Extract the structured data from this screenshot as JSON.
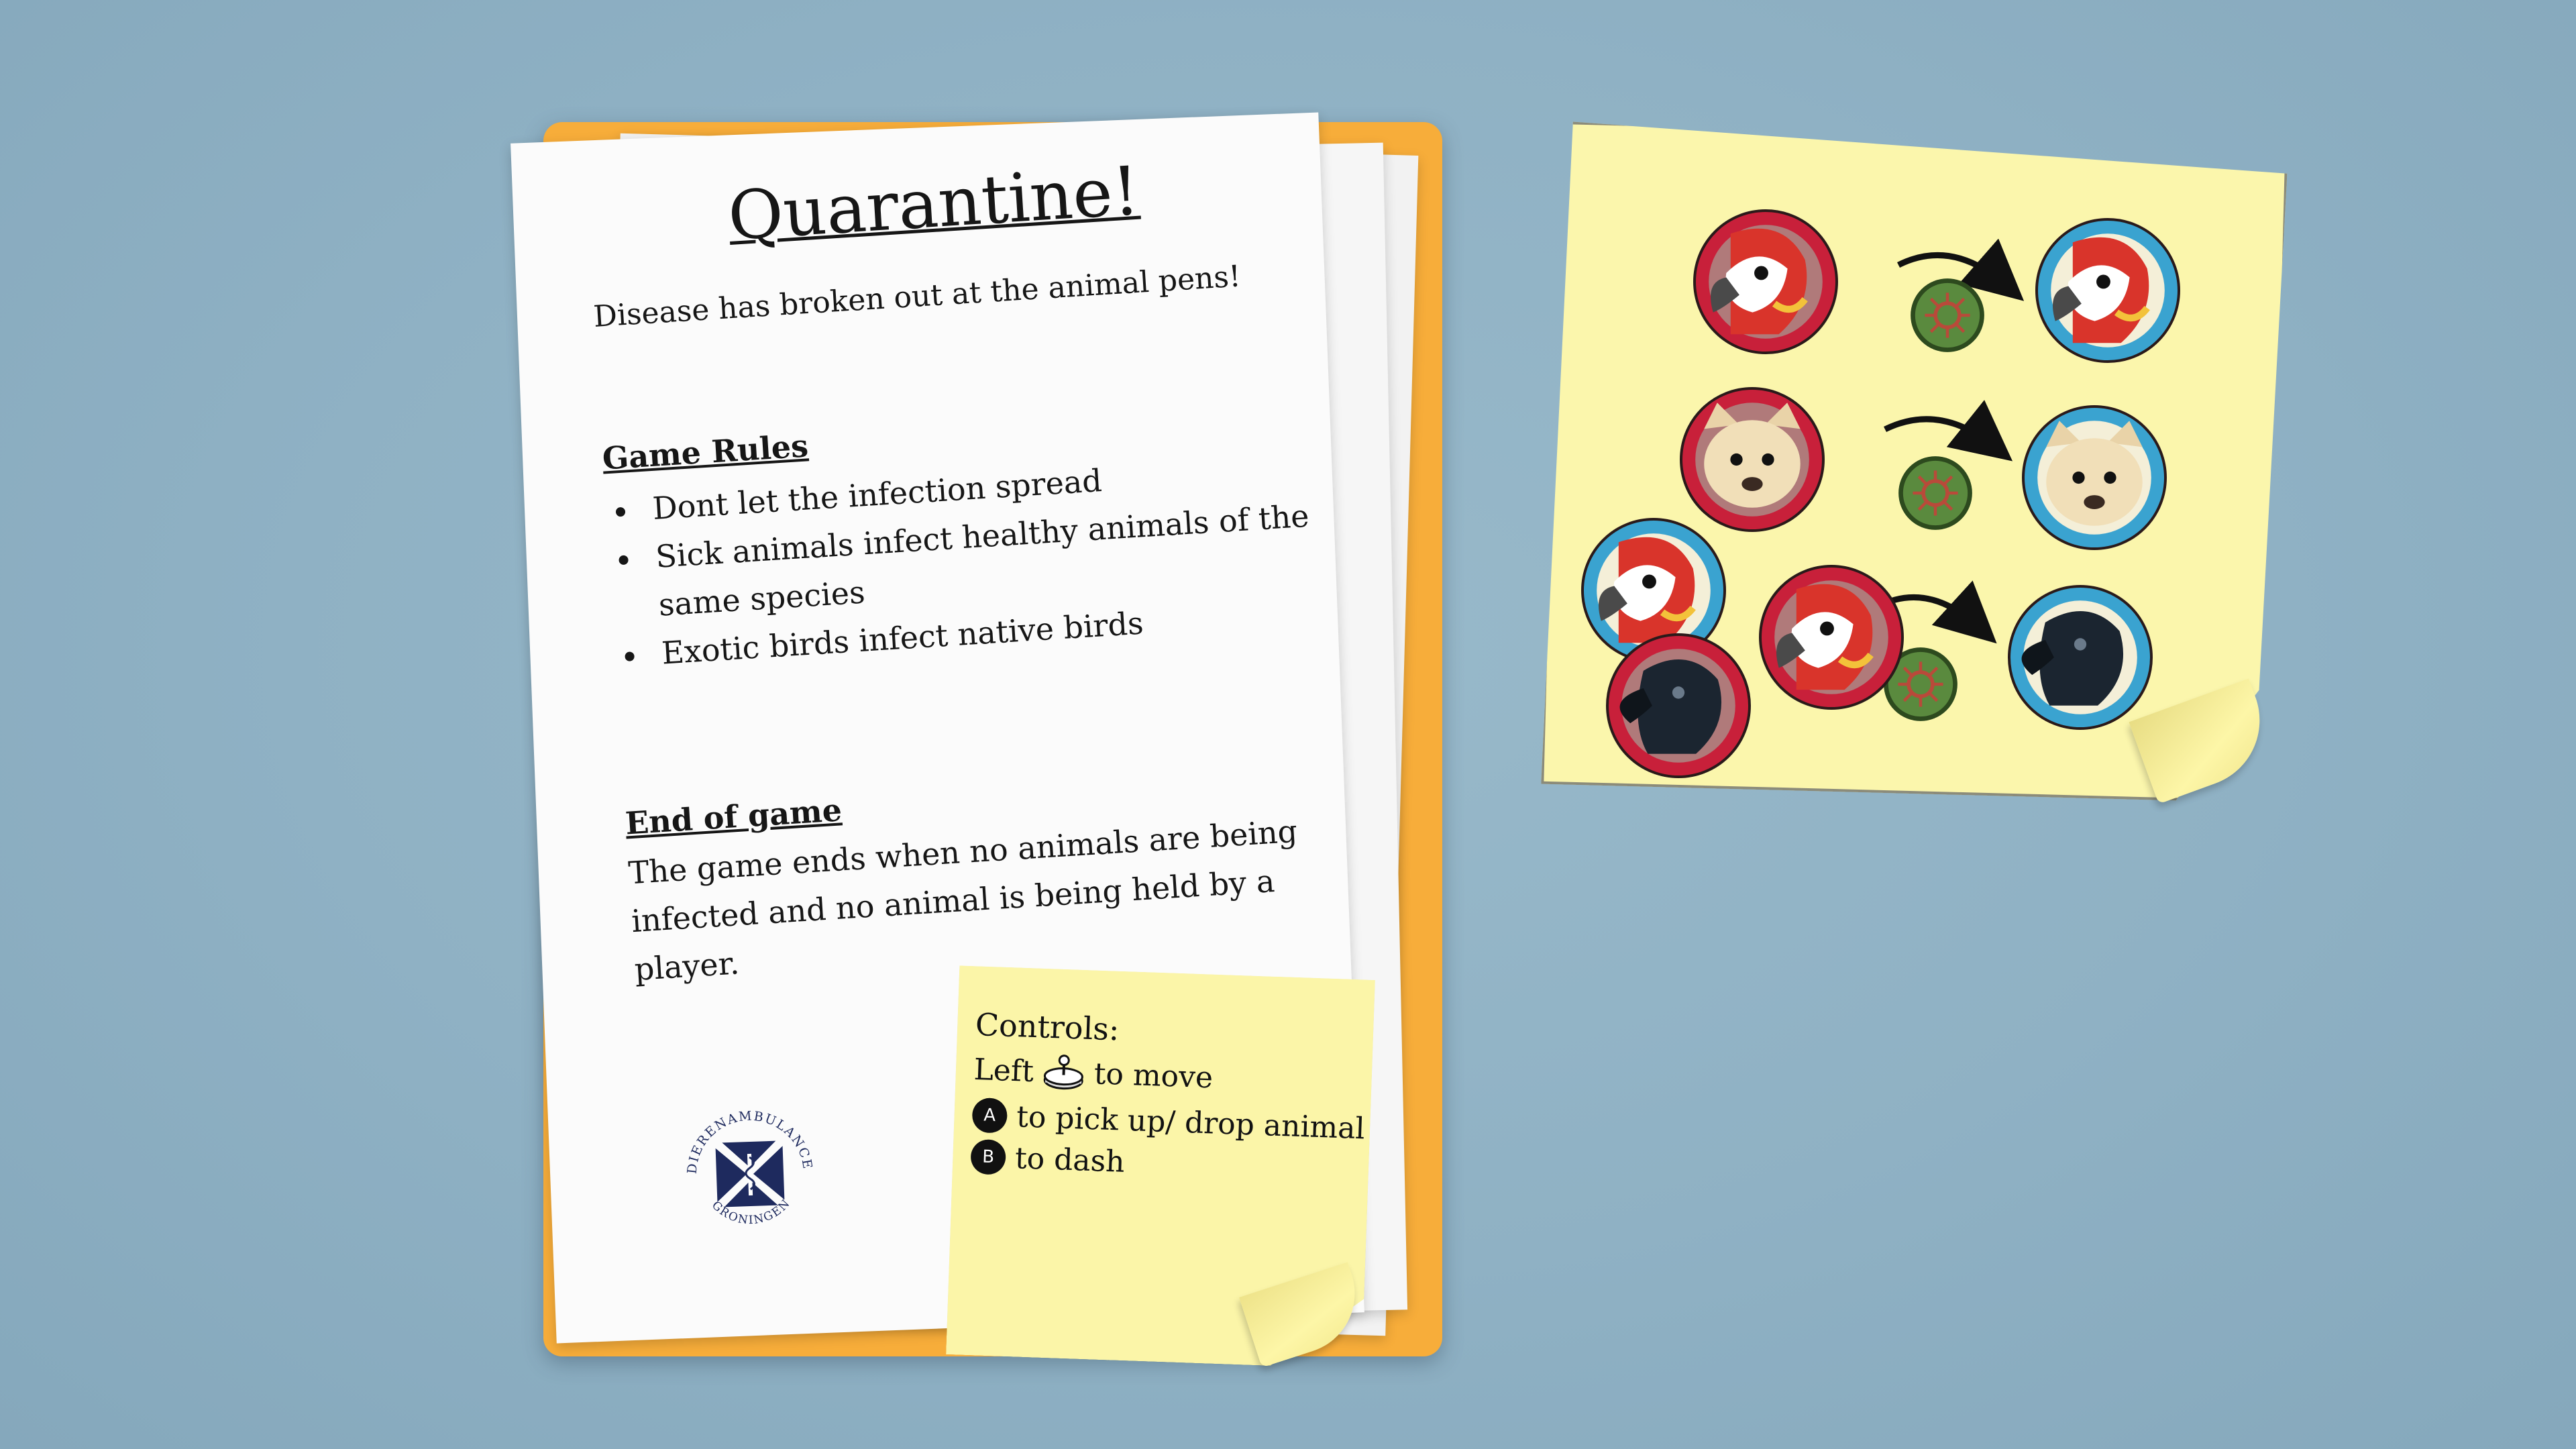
{
  "rules_sheet": {
    "title": "Quarantine!",
    "intro": "Disease has broken out at the animal pens!",
    "rules_heading": "Game Rules",
    "rules": [
      "Dont let the infection spread",
      "Sick animals infect healthy animals of the same species",
      "Exotic birds infect native birds"
    ],
    "end_heading": "End of game",
    "end_text": "The game ends when no animals are being infected and no animal is being held by a player."
  },
  "logo": {
    "text_top": "DIERENAMBULANCE",
    "text_bottom": "GRONINGEN"
  },
  "controls": {
    "title": "Controls:",
    "move_prefix": "Left",
    "move_suffix": "to move",
    "pickup_button": "A",
    "pickup_text": "to pick up/ drop animal",
    "dash_button": "B",
    "dash_text": "to dash"
  },
  "infection_diagram": {
    "sick_color": "#c8203a",
    "healthy_color": "#3aa3d0",
    "virus_color": "#5a8a3e",
    "rows": [
      {
        "sick": [
          "parrot-icon"
        ],
        "healthy": "parrot-icon"
      },
      {
        "sick": [
          "dog-icon"
        ],
        "healthy": "dog-icon"
      },
      {
        "sick": [
          "parrot-icon",
          "parrot-icon",
          "crow-icon"
        ],
        "healthy": "crow-icon"
      }
    ]
  }
}
